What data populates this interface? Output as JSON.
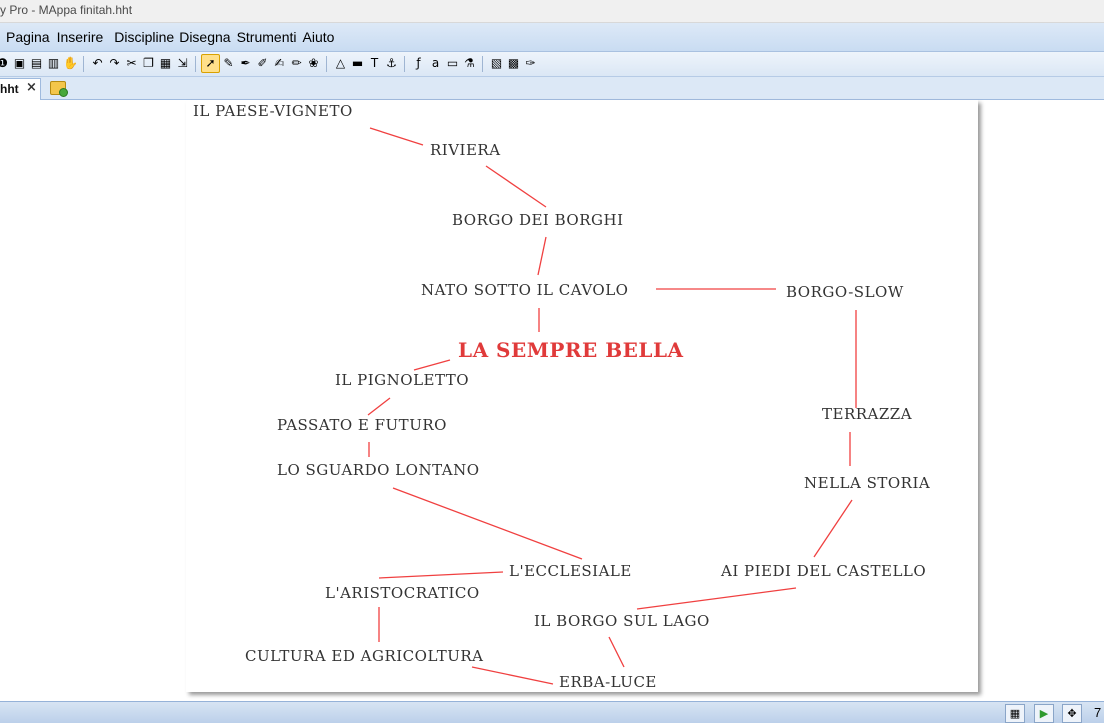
{
  "window": {
    "title": "y Pro - MAppa finitah.hht"
  },
  "menu": [
    "Pagina",
    "Inserire",
    "Discipline",
    "Disegna",
    "Strumenti",
    "Aiuto"
  ],
  "toolbar_icons": [
    "open-icon",
    "save-icon",
    "export-icon",
    "print-icon",
    "hand-icon",
    "undo-icon",
    "redo-icon",
    "cut-icon",
    "copy-icon",
    "paste-icon",
    "import-icon",
    "pointer-icon",
    "pencil-icon",
    "pen-icon",
    "brush-icon",
    "marker-icon",
    "edit-icon",
    "shape-icon",
    "triangle-icon",
    "film-icon",
    "text-icon",
    "anchor-icon",
    "formula-icon",
    "spelling-icon",
    "dictionary-icon",
    "flask-icon",
    "picture-icon",
    "media-icon",
    "signature-icon"
  ],
  "toolbar_glyphs": {
    "open-icon": "❶",
    "save-icon": "▣",
    "export-icon": "▤",
    "print-icon": "▥",
    "hand-icon": "✋",
    "undo-icon": "↶",
    "redo-icon": "↷",
    "cut-icon": "✂",
    "copy-icon": "❐",
    "paste-icon": "▦",
    "import-icon": "⇲",
    "pointer-icon": "➚",
    "pencil-icon": "✎",
    "pen-icon": "✒",
    "brush-icon": "✐",
    "marker-icon": "✍",
    "edit-icon": "✏",
    "shape-icon": "❀",
    "triangle-icon": "△",
    "film-icon": "▬",
    "text-icon": "T",
    "anchor-icon": "⚓",
    "formula-icon": "ƒ",
    "spelling-icon": "a",
    "dictionary-icon": "▭",
    "flask-icon": "⚗",
    "picture-icon": "▧",
    "media-icon": "▩",
    "signature-icon": "✑"
  },
  "tab": {
    "label": "hht",
    "close": "×"
  },
  "map": {
    "central": "LA SEMPRE BELLA",
    "nodes": [
      "IL PAESE-VIGNETO",
      "RIVIERA",
      "BORGO DEI BORGHI",
      "NATO SOTTO IL CAVOLO",
      "BORGO-SLOW",
      "IL PIGNOLETTO",
      "PASSATO E FUTURO",
      "LO SGUARDO LONTANO",
      "TERRAZZA",
      "NELLA STORIA",
      "L'ECCLESIALE",
      "AI PIEDI DEL CASTELLO",
      "L'ARISTOCRATICO",
      "IL BORGO SUL LAGO",
      "CULTURA ED AGRICOLTURA",
      "ERBA-LUCE"
    ],
    "link_color": "#f04040"
  },
  "status": {
    "zoom": "7"
  }
}
